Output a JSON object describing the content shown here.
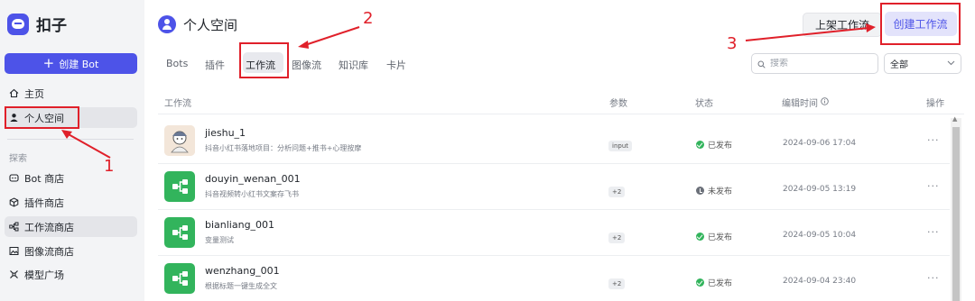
{
  "app": {
    "name": "扣子"
  },
  "sidebar": {
    "create_bot_label": "创建 Bot",
    "nav": [
      {
        "label": "主页",
        "icon": "home-icon"
      },
      {
        "label": "个人空间",
        "icon": "user-icon"
      }
    ],
    "explore_title": "探索",
    "explore": [
      {
        "label": "Bot 商店",
        "icon": "bot-icon"
      },
      {
        "label": "插件商店",
        "icon": "plugin-icon"
      },
      {
        "label": "工作流商店",
        "icon": "workflow-icon"
      },
      {
        "label": "图像流商店",
        "icon": "image-flow-icon"
      },
      {
        "label": "模型广场",
        "icon": "model-icon"
      }
    ]
  },
  "header": {
    "title": "个人空间",
    "list_button": "上架工作流",
    "create_button": "创建工作流"
  },
  "tabs": [
    "Bots",
    "插件",
    "工作流",
    "图像流",
    "知识库",
    "卡片"
  ],
  "search": {
    "placeholder": "搜索"
  },
  "filter": {
    "value": "全部"
  },
  "table": {
    "columns": [
      "工作流",
      "参数",
      "状态",
      "编辑时间",
      "操作"
    ],
    "rows": [
      {
        "name": "jieshu_1",
        "desc": "抖音小红书落地项目：分析问题+推书+心理按摩",
        "param": "input",
        "status": "已发布",
        "time": "2024-09-06 17:04"
      },
      {
        "name": "douyin_wenan_001",
        "desc": "抖音视频转小红书文案存飞书",
        "param": "+2",
        "status": "未发布",
        "time": "2024-09-05 13:19"
      },
      {
        "name": "bianliang_001",
        "desc": "变量测试",
        "param": "+2",
        "status": "已发布",
        "time": "2024-09-05 10:04"
      },
      {
        "name": "wenzhang_001",
        "desc": "根据标题一键生成全文",
        "param": "+2",
        "status": "已发布",
        "time": "2024-09-04 23:40"
      }
    ]
  },
  "annotations": [
    "1",
    "2",
    "3"
  ],
  "colors": {
    "accent": "#4d53e8",
    "annotation": "#e0202a",
    "success": "#32b45c"
  }
}
